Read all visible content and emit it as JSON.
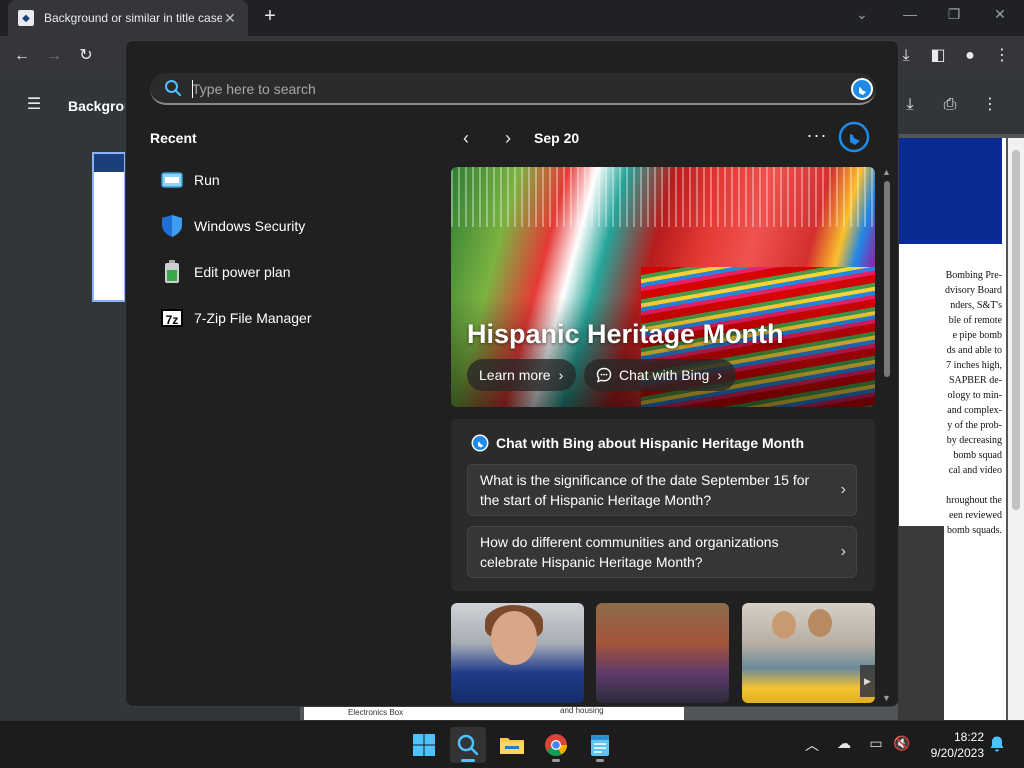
{
  "browser": {
    "tab_title": "Background or similar in title case",
    "pdf_title": "Backgrou",
    "page_text": "Bombing Pre-\ndvisory Board\nnders, S&T's\nble of remote\ne pipe bomb\nds and able to\n7 inches high,\nSAPBER de-\nology to min-\nand complex-\ny of the prob-\nby decreasing\nbomb squad\ncal and video\n\nhroughout the\neen reviewed\nbomb squads.",
    "bottom_labels": [
      "Electronics Box",
      "and housing"
    ]
  },
  "search": {
    "placeholder": "Type here to search"
  },
  "recent": {
    "title": "Recent",
    "items": [
      {
        "label": "Run",
        "icon": "run-icon"
      },
      {
        "label": "Windows Security",
        "icon": "shield-icon"
      },
      {
        "label": "Edit power plan",
        "icon": "battery-icon"
      },
      {
        "label": "7-Zip File Manager",
        "icon": "7zip-icon",
        "glyph": "7z"
      }
    ]
  },
  "highlights": {
    "date": "Sep 20",
    "more": "···",
    "hero_title": "Hispanic Heritage Month",
    "learn_more": "Learn more",
    "chat_with_bing": "Chat with Bing",
    "chat_heading": "Chat with Bing about Hispanic Heritage Month",
    "questions": [
      "What is the significance of the date September 15 for the start of Hispanic Heritage Month?",
      "How do different communities and organizations celebrate Hispanic Heritage Month?"
    ]
  },
  "taskbar": {
    "time": "18:22",
    "date": "9/20/2023"
  },
  "colors": {
    "accent": "#4cc2ff",
    "flyout_bg": "#202020",
    "card_bg": "#2b2b2b",
    "bing_blue": "#1e8be8"
  }
}
